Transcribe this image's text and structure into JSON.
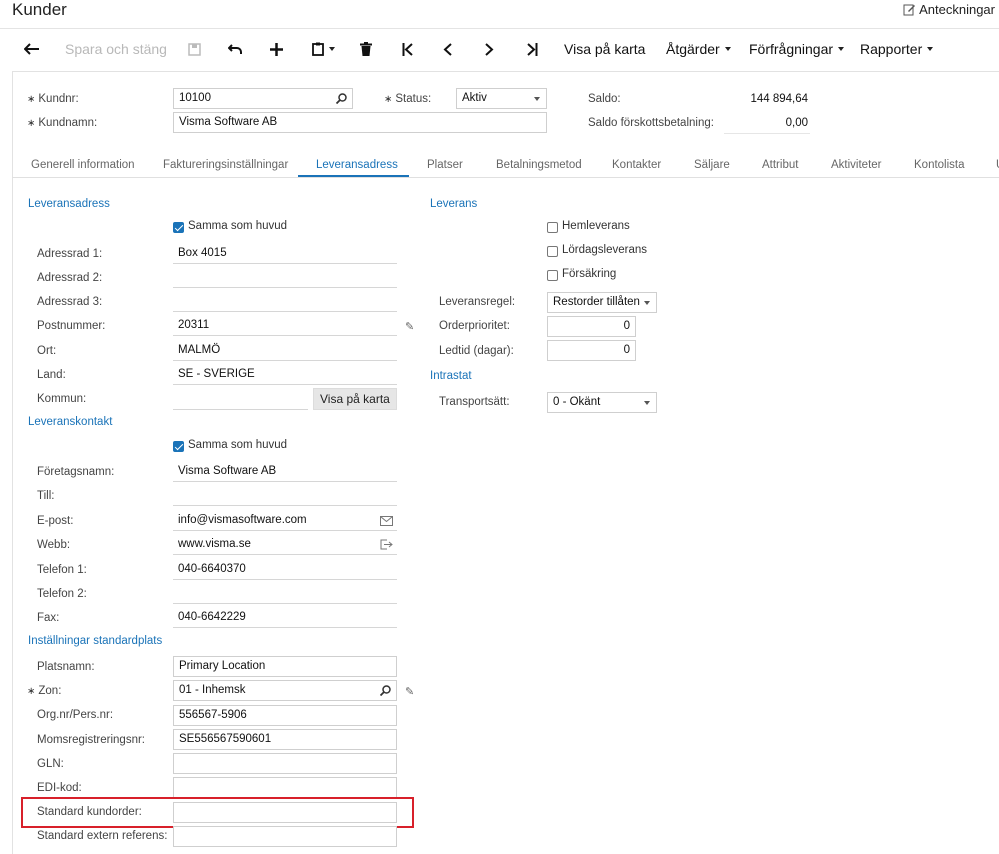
{
  "header": {
    "title": "Kunder",
    "notes_label": "Anteckningar"
  },
  "toolbar": {
    "save_close": "Spara och stäng",
    "show_on_map": "Visa på karta",
    "actions": "Åtgärder",
    "inquiries": "Förfrågningar",
    "reports": "Rapporter"
  },
  "form": {
    "customer_no_label": "Kundnr:",
    "customer_no": "10100",
    "status_label": "Status:",
    "status": "Aktiv",
    "balance_label": "Saldo:",
    "balance": "144 894,64",
    "customer_name_label": "Kundnamn:",
    "customer_name": "Visma Software AB",
    "prepayment_balance_label": "Saldo förskottsbetalning:",
    "prepayment_balance": "0,00"
  },
  "tabs": [
    "Generell information",
    "Faktureringsinställningar",
    "Leveransadress",
    "Platser",
    "Betalningsmetod",
    "Kontakter",
    "Säljare",
    "Attribut",
    "Aktiviteter",
    "Kontolista",
    "U"
  ],
  "delivery_address": {
    "section": "Leveransadress",
    "same_as_main": "Samma som huvud",
    "address1_label": "Adressrad 1:",
    "address1": "Box 4015",
    "address2_label": "Adressrad 2:",
    "address2": "",
    "address3_label": "Adressrad 3:",
    "address3": "",
    "postal_label": "Postnummer:",
    "postal": "20311",
    "city_label": "Ort:",
    "city": "MALMÖ",
    "country_label": "Land:",
    "country": "SE - SVERIGE",
    "municipality_label": "Kommun:",
    "municipality": "",
    "map_button": "Visa på karta"
  },
  "delivery_contact": {
    "section": "Leveranskontakt",
    "same_as_main": "Samma som huvud",
    "company_label": "Företagsnamn:",
    "company": "Visma Software AB",
    "to_label": "Till:",
    "to": "",
    "email_label": "E-post:",
    "email": "info@vismasoftware.com",
    "web_label": "Webb:",
    "web": "www.visma.se",
    "phone1_label": "Telefon 1:",
    "phone1": "040-6640370",
    "phone2_label": "Telefon 2:",
    "phone2": "",
    "fax_label": "Fax:",
    "fax": "040-6642229"
  },
  "default_location": {
    "section": "Inställningar standardplats",
    "location_name_label": "Platsnamn:",
    "location_name": "Primary Location",
    "zone_label": "Zon:",
    "zone": "01 - Inhemsk",
    "org_no_label": "Org.nr/Pers.nr:",
    "org_no": "556567-5906",
    "vat_no_label": "Momsregistreringsnr:",
    "vat_no": "SE556567590601",
    "gln_label": "GLN:",
    "gln": "",
    "edi_label": "EDI-kod:",
    "edi": "",
    "std_order_label": "Standard kundorder:",
    "std_order": "",
    "ext_ref_label": "Standard extern referens:",
    "ext_ref": ""
  },
  "delivery": {
    "section": "Leverans",
    "home_delivery": "Hemleverans",
    "saturday_delivery": "Lördagsleverans",
    "insurance": "Försäkring",
    "rule_label": "Leveransregel:",
    "rule": "Restorder tillåten",
    "priority_label": "Orderprioritet:",
    "priority": "0",
    "leadtime_label": "Ledtid (dagar):",
    "leadtime": "0",
    "intrastat_section": "Intrastat",
    "transport_label": "Transportsätt:",
    "transport": "0 - Okänt"
  }
}
